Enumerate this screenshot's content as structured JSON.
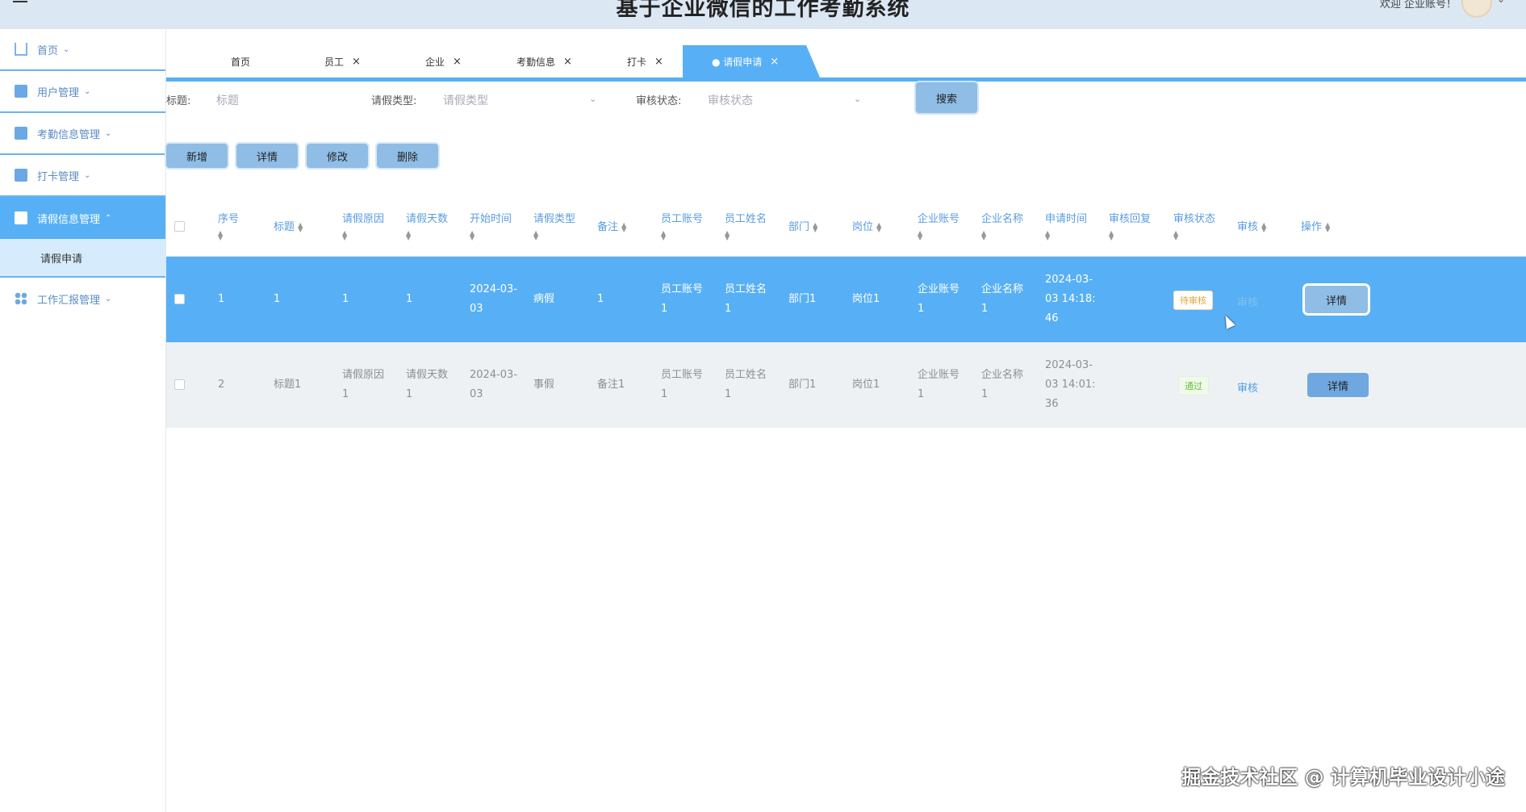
{
  "header": {
    "title": "基于企业微信的工作考勤系统",
    "welcome": "欢迎 企业账号！"
  },
  "sidebar": {
    "items": [
      {
        "label": "首页",
        "icon": "home-icon"
      },
      {
        "label": "用户管理",
        "icon": "user-icon"
      },
      {
        "label": "考勤信息管理",
        "icon": "attendance-icon"
      },
      {
        "label": "打卡管理",
        "icon": "clock-in-icon"
      },
      {
        "label": "请假信息管理",
        "icon": "leave-icon",
        "active": true
      },
      {
        "label": "工作汇报管理",
        "icon": "report-icon"
      }
    ],
    "sub_item": "请假申请"
  },
  "tabs": [
    {
      "label": "首页"
    },
    {
      "label": "员工"
    },
    {
      "label": "企业"
    },
    {
      "label": "考勤信息"
    },
    {
      "label": "打卡"
    },
    {
      "label": "● 请假申请",
      "active": true
    }
  ],
  "filters": {
    "title_label": "标题:",
    "title_placeholder": "标题",
    "type_label": "请假类型:",
    "type_placeholder": "请假类型",
    "status_label": "审核状态:",
    "status_placeholder": "审核状态",
    "search_button": "搜索"
  },
  "actions": {
    "add": "新增",
    "detail": "详情",
    "edit": "修改",
    "delete": "删除"
  },
  "table": {
    "columns": [
      "序号",
      "标题",
      "请假原因",
      "请假天数",
      "开始时间",
      "请假类型",
      "备注",
      "员工账号",
      "员工姓名",
      "部门",
      "岗位",
      "企业账号",
      "企业名称",
      "申请时间",
      "审核回复",
      "审核状态",
      "审核",
      "操作"
    ],
    "rows": [
      {
        "no": "1",
        "title": "1",
        "reason": "1",
        "days": "1",
        "start_a": "2024-03-",
        "start_b": "03",
        "type": "病假",
        "remark": "1",
        "emp_acc_a": "员工账号",
        "emp_acc_b": "1",
        "emp_name_a": "员工姓名",
        "emp_name_b": "1",
        "dept": "部门1",
        "post": "岗位1",
        "ent_acc_a": "企业账号",
        "ent_acc_b": "1",
        "ent_name_a": "企业名称",
        "ent_name_b": "1",
        "apply_a": "2024-03-",
        "apply_b": "03 14:18:",
        "apply_c": "46",
        "reply": "",
        "status": "待审核",
        "review": "审核",
        "op": "详情"
      },
      {
        "no": "2",
        "title": "标题1",
        "reason_a": "请假原因",
        "reason_b": "1",
        "days_a": "请假天数",
        "days_b": "1",
        "start_a": "2024-03-",
        "start_b": "03",
        "type": "事假",
        "remark": "备注1",
        "emp_acc_a": "员工账号",
        "emp_acc_b": "1",
        "emp_name_a": "员工姓名",
        "emp_name_b": "1",
        "dept": "部门1",
        "post": "岗位1",
        "ent_acc_a": "企业账号",
        "ent_acc_b": "1",
        "ent_name_a": "企业名称",
        "ent_name_b": "1",
        "apply_a": "2024-03-",
        "apply_b": "03 14:01:",
        "apply_c": "36",
        "reply": "",
        "status": "通过",
        "review": "审核",
        "op": "详情"
      }
    ]
  },
  "watermark": "掘金技术社区 @ 计算机毕业设计小途",
  "colors": {
    "primary": "#57b0f5",
    "button": "#8fbde6",
    "header_bg": "#dce7f4",
    "pending": "#e6a23c",
    "pass": "#67c23a"
  }
}
